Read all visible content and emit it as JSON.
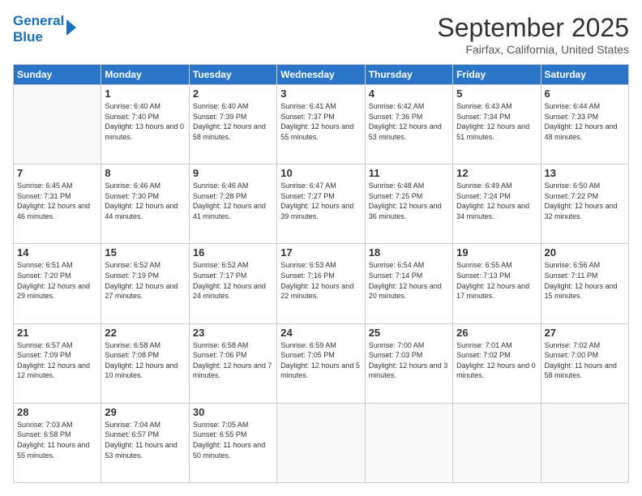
{
  "logo": {
    "line1": "General",
    "line2": "Blue"
  },
  "header": {
    "title": "September 2025",
    "location": "Fairfax, California, United States"
  },
  "weekdays": [
    "Sunday",
    "Monday",
    "Tuesday",
    "Wednesday",
    "Thursday",
    "Friday",
    "Saturday"
  ],
  "weeks": [
    [
      {
        "day": "",
        "sunrise": "",
        "sunset": "",
        "daylight": ""
      },
      {
        "day": "1",
        "sunrise": "Sunrise: 6:40 AM",
        "sunset": "Sunset: 7:40 PM",
        "daylight": "Daylight: 13 hours and 0 minutes."
      },
      {
        "day": "2",
        "sunrise": "Sunrise: 6:40 AM",
        "sunset": "Sunset: 7:39 PM",
        "daylight": "Daylight: 12 hours and 58 minutes."
      },
      {
        "day": "3",
        "sunrise": "Sunrise: 6:41 AM",
        "sunset": "Sunset: 7:37 PM",
        "daylight": "Daylight: 12 hours and 55 minutes."
      },
      {
        "day": "4",
        "sunrise": "Sunrise: 6:42 AM",
        "sunset": "Sunset: 7:36 PM",
        "daylight": "Daylight: 12 hours and 53 minutes."
      },
      {
        "day": "5",
        "sunrise": "Sunrise: 6:43 AM",
        "sunset": "Sunset: 7:34 PM",
        "daylight": "Daylight: 12 hours and 51 minutes."
      },
      {
        "day": "6",
        "sunrise": "Sunrise: 6:44 AM",
        "sunset": "Sunset: 7:33 PM",
        "daylight": "Daylight: 12 hours and 48 minutes."
      }
    ],
    [
      {
        "day": "7",
        "sunrise": "Sunrise: 6:45 AM",
        "sunset": "Sunset: 7:31 PM",
        "daylight": "Daylight: 12 hours and 46 minutes."
      },
      {
        "day": "8",
        "sunrise": "Sunrise: 6:46 AM",
        "sunset": "Sunset: 7:30 PM",
        "daylight": "Daylight: 12 hours and 44 minutes."
      },
      {
        "day": "9",
        "sunrise": "Sunrise: 6:46 AM",
        "sunset": "Sunset: 7:28 PM",
        "daylight": "Daylight: 12 hours and 41 minutes."
      },
      {
        "day": "10",
        "sunrise": "Sunrise: 6:47 AM",
        "sunset": "Sunset: 7:27 PM",
        "daylight": "Daylight: 12 hours and 39 minutes."
      },
      {
        "day": "11",
        "sunrise": "Sunrise: 6:48 AM",
        "sunset": "Sunset: 7:25 PM",
        "daylight": "Daylight: 12 hours and 36 minutes."
      },
      {
        "day": "12",
        "sunrise": "Sunrise: 6:49 AM",
        "sunset": "Sunset: 7:24 PM",
        "daylight": "Daylight: 12 hours and 34 minutes."
      },
      {
        "day": "13",
        "sunrise": "Sunrise: 6:50 AM",
        "sunset": "Sunset: 7:22 PM",
        "daylight": "Daylight: 12 hours and 32 minutes."
      }
    ],
    [
      {
        "day": "14",
        "sunrise": "Sunrise: 6:51 AM",
        "sunset": "Sunset: 7:20 PM",
        "daylight": "Daylight: 12 hours and 29 minutes."
      },
      {
        "day": "15",
        "sunrise": "Sunrise: 6:52 AM",
        "sunset": "Sunset: 7:19 PM",
        "daylight": "Daylight: 12 hours and 27 minutes."
      },
      {
        "day": "16",
        "sunrise": "Sunrise: 6:52 AM",
        "sunset": "Sunset: 7:17 PM",
        "daylight": "Daylight: 12 hours and 24 minutes."
      },
      {
        "day": "17",
        "sunrise": "Sunrise: 6:53 AM",
        "sunset": "Sunset: 7:16 PM",
        "daylight": "Daylight: 12 hours and 22 minutes."
      },
      {
        "day": "18",
        "sunrise": "Sunrise: 6:54 AM",
        "sunset": "Sunset: 7:14 PM",
        "daylight": "Daylight: 12 hours and 20 minutes."
      },
      {
        "day": "19",
        "sunrise": "Sunrise: 6:55 AM",
        "sunset": "Sunset: 7:13 PM",
        "daylight": "Daylight: 12 hours and 17 minutes."
      },
      {
        "day": "20",
        "sunrise": "Sunrise: 6:56 AM",
        "sunset": "Sunset: 7:11 PM",
        "daylight": "Daylight: 12 hours and 15 minutes."
      }
    ],
    [
      {
        "day": "21",
        "sunrise": "Sunrise: 6:57 AM",
        "sunset": "Sunset: 7:09 PM",
        "daylight": "Daylight: 12 hours and 12 minutes."
      },
      {
        "day": "22",
        "sunrise": "Sunrise: 6:58 AM",
        "sunset": "Sunset: 7:08 PM",
        "daylight": "Daylight: 12 hours and 10 minutes."
      },
      {
        "day": "23",
        "sunrise": "Sunrise: 6:58 AM",
        "sunset": "Sunset: 7:06 PM",
        "daylight": "Daylight: 12 hours and 7 minutes."
      },
      {
        "day": "24",
        "sunrise": "Sunrise: 6:59 AM",
        "sunset": "Sunset: 7:05 PM",
        "daylight": "Daylight: 12 hours and 5 minutes."
      },
      {
        "day": "25",
        "sunrise": "Sunrise: 7:00 AM",
        "sunset": "Sunset: 7:03 PM",
        "daylight": "Daylight: 12 hours and 3 minutes."
      },
      {
        "day": "26",
        "sunrise": "Sunrise: 7:01 AM",
        "sunset": "Sunset: 7:02 PM",
        "daylight": "Daylight: 12 hours and 0 minutes."
      },
      {
        "day": "27",
        "sunrise": "Sunrise: 7:02 AM",
        "sunset": "Sunset: 7:00 PM",
        "daylight": "Daylight: 11 hours and 58 minutes."
      }
    ],
    [
      {
        "day": "28",
        "sunrise": "Sunrise: 7:03 AM",
        "sunset": "Sunset: 6:58 PM",
        "daylight": "Daylight: 11 hours and 55 minutes."
      },
      {
        "day": "29",
        "sunrise": "Sunrise: 7:04 AM",
        "sunset": "Sunset: 6:57 PM",
        "daylight": "Daylight: 11 hours and 53 minutes."
      },
      {
        "day": "30",
        "sunrise": "Sunrise: 7:05 AM",
        "sunset": "Sunset: 6:55 PM",
        "daylight": "Daylight: 11 hours and 50 minutes."
      },
      {
        "day": "",
        "sunrise": "",
        "sunset": "",
        "daylight": ""
      },
      {
        "day": "",
        "sunrise": "",
        "sunset": "",
        "daylight": ""
      },
      {
        "day": "",
        "sunrise": "",
        "sunset": "",
        "daylight": ""
      },
      {
        "day": "",
        "sunrise": "",
        "sunset": "",
        "daylight": ""
      }
    ]
  ]
}
